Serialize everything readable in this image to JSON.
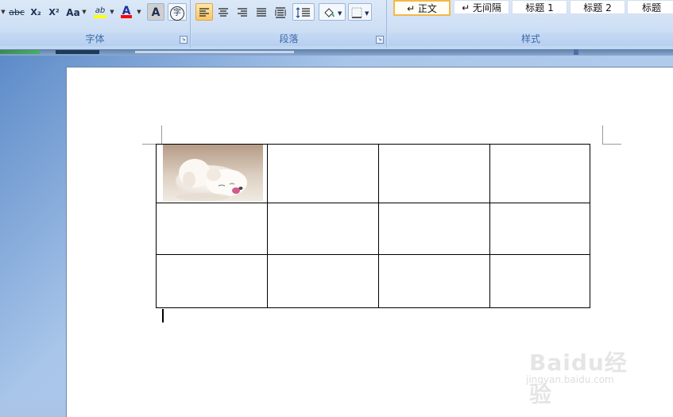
{
  "ribbon": {
    "font_group": {
      "label": "字体",
      "buttons": {
        "strikethrough": "abc",
        "subscript": "X₂",
        "superscript": "X²",
        "change_case": "Aa",
        "highlight": "ab",
        "font_color": "A",
        "char_shading": "A",
        "enclose_char": "字"
      }
    },
    "paragraph_group": {
      "label": "段落"
    },
    "styles_group": {
      "label": "样式",
      "items": [
        "↵ 正文",
        "↵ 无间隔",
        "标题 1",
        "标题 2",
        "标题"
      ],
      "selected_index": 0
    }
  },
  "document": {
    "table": {
      "rows": 3,
      "cols": 4,
      "image_cell": "r1c1"
    }
  },
  "watermark": {
    "brand": "Baidu经验",
    "url": "jingyan.baidu.com"
  },
  "colors": {
    "highlight_yellow": "#ffff00",
    "font_red": "#ff0000",
    "active_orange": "#f8c76a"
  },
  "icons": {
    "align_left": "align-left-icon",
    "align_center": "align-center-icon",
    "align_right": "align-right-icon",
    "justify": "justify-icon",
    "distributed": "distributed-icon",
    "line_spacing": "line-spacing-icon",
    "shading": "paint-bucket-icon",
    "borders": "borders-icon"
  }
}
